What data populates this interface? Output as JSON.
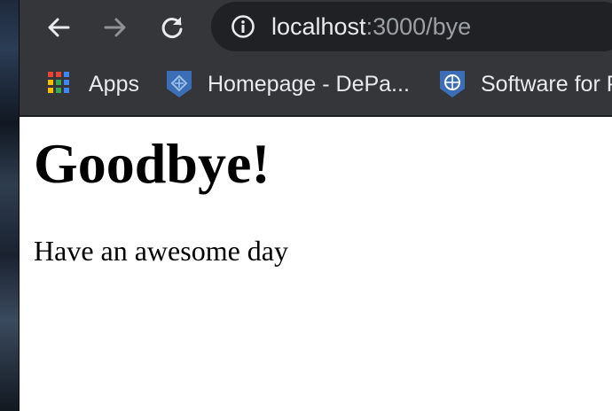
{
  "browser": {
    "address_bar": {
      "host": "localhost",
      "rest": ":3000/bye"
    },
    "bookmarks": [
      {
        "label": "Apps",
        "icon": "apps-grid-icon"
      },
      {
        "label": "Homepage - DePa...",
        "icon": "depaul-shield-icon"
      },
      {
        "label": "Software for P",
        "icon": "software-shield-icon"
      }
    ]
  },
  "page": {
    "heading": "Goodbye!",
    "message": "Have an awesome day"
  },
  "colors": {
    "toolbar_bg": "#35363a",
    "omnibox_bg": "#202124",
    "text_light": "#e8eaed",
    "text_dim": "#9aa0a6",
    "shield_blue": "#3b6eb6"
  }
}
